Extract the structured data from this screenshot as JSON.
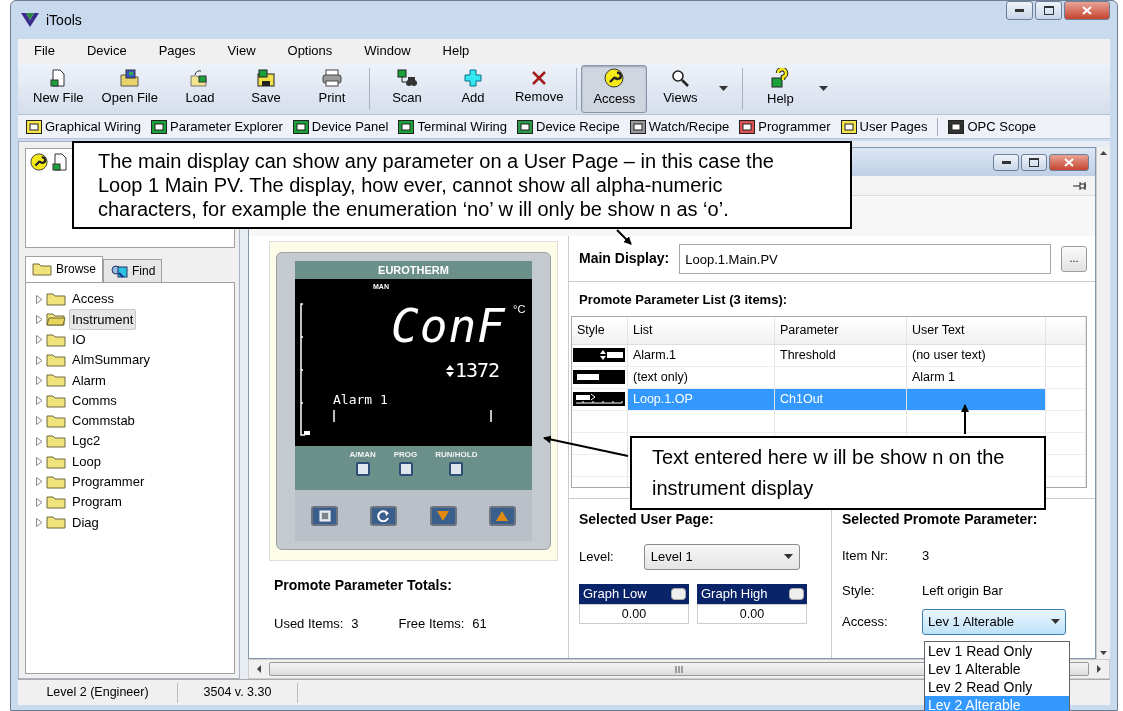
{
  "window": {
    "title": "iTools"
  },
  "menu": [
    "File",
    "Device",
    "Pages",
    "View",
    "Options",
    "Window",
    "Help"
  ],
  "toolbar": [
    {
      "label": "New File",
      "pressed": false
    },
    {
      "label": "Open File",
      "pressed": false
    },
    {
      "label": "Load",
      "pressed": false
    },
    {
      "label": "Save",
      "pressed": false
    },
    {
      "label": "Print",
      "pressed": false
    },
    {
      "label": "Scan",
      "pressed": false,
      "separator_before": true
    },
    {
      "label": "Add",
      "pressed": false
    },
    {
      "label": "Remove",
      "pressed": false
    },
    {
      "label": "Access",
      "pressed": true,
      "separator_before": true
    },
    {
      "label": "Views",
      "pressed": false,
      "dropdown": true
    },
    {
      "label": "Help",
      "pressed": false,
      "dropdown": true,
      "separator_before": true
    }
  ],
  "quick_bar": [
    {
      "label": "Graphical Wiring"
    },
    {
      "label": "Parameter Explorer"
    },
    {
      "label": "Device Panel"
    },
    {
      "label": "Terminal Wiring"
    },
    {
      "label": "Device Recipe"
    },
    {
      "label": "Watch/Recipe"
    },
    {
      "label": "Programmer"
    },
    {
      "label": "User Pages"
    },
    {
      "label": "OPC Scope",
      "separator_before": true
    }
  ],
  "browser": {
    "tabs": [
      {
        "label": "Browse",
        "selected": true
      },
      {
        "label": "Find",
        "selected": false
      }
    ],
    "items": [
      {
        "label": "Access",
        "selected": false
      },
      {
        "label": "Instrument",
        "selected": true
      },
      {
        "label": "IO",
        "selected": false
      },
      {
        "label": "AlmSummary",
        "selected": false
      },
      {
        "label": "Alarm",
        "selected": false
      },
      {
        "label": "Comms",
        "selected": false
      },
      {
        "label": "Commstab",
        "selected": false
      },
      {
        "label": "Lgc2",
        "selected": false
      },
      {
        "label": "Loop",
        "selected": false
      },
      {
        "label": "Programmer",
        "selected": false
      },
      {
        "label": "Program",
        "selected": false
      },
      {
        "label": "Diag",
        "selected": false
      }
    ]
  },
  "instrument": {
    "brand": "EUROTHERM",
    "mode": "MAN",
    "main": "ConF",
    "unit": "°C",
    "value": "1372",
    "message": "Alarm 1",
    "key_labels": [
      "A/MAN",
      "PROG",
      "RUN/HOLD"
    ]
  },
  "main_display": {
    "label": "Main Display:",
    "value": "Loop.1.Main.PV",
    "browse": "..."
  },
  "promote_list": {
    "title": "Promote Parameter List (3 items):",
    "columns": [
      "Style",
      "List",
      "Parameter",
      "User Text"
    ],
    "rows": [
      {
        "kind": "value",
        "list": "Alarm.1",
        "parameter": "Threshold",
        "user_text": "(no user text)",
        "selected": false
      },
      {
        "kind": "text",
        "list": "(text only)",
        "user_text": "Alarm 1",
        "selected": false
      },
      {
        "kind": "bar",
        "list": "Loop.1.OP",
        "parameter": "Ch1Out",
        "selected": true
      }
    ]
  },
  "totals": {
    "title": "Promote Parameter Totals:",
    "used_label": "Used Items:",
    "used": "3",
    "free_label": "Free Items:",
    "free": "61"
  },
  "user_page": {
    "title": "Selected User Page:",
    "level_label": "Level:",
    "level": "Level 1",
    "graphs": [
      {
        "label": "Graph Low",
        "value": "0.00"
      },
      {
        "label": "Graph High",
        "value": "0.00"
      }
    ]
  },
  "promote_parameter": {
    "title": "Selected Promote Parameter:",
    "item_label": "Item Nr:",
    "item": "3",
    "style_label": "Style:",
    "style": "Left origin Bar",
    "access_label": "Access:",
    "access": "Lev 1 Alterable",
    "options": [
      {
        "label": "Lev 1 Read Only",
        "selected": false
      },
      {
        "label": "Lev 1 Alterable",
        "selected": false
      },
      {
        "label": "Lev 2 Read Only",
        "selected": false
      },
      {
        "label": "Lev 2 Alterable",
        "selected": true
      }
    ]
  },
  "callouts": [
    "The main display can show any parameter on a User Page – in this case the Loop 1 Main PV.  The display, how ever, cannot show all alpha-numeric characters, for example the enumeration ‘no’ w ill only be show n as ‘o’.",
    "Text entered here w ill be show n on the instrument display"
  ],
  "status_bar": [
    "Level 2 (Engineer)",
    "3504 v. 3.30"
  ]
}
